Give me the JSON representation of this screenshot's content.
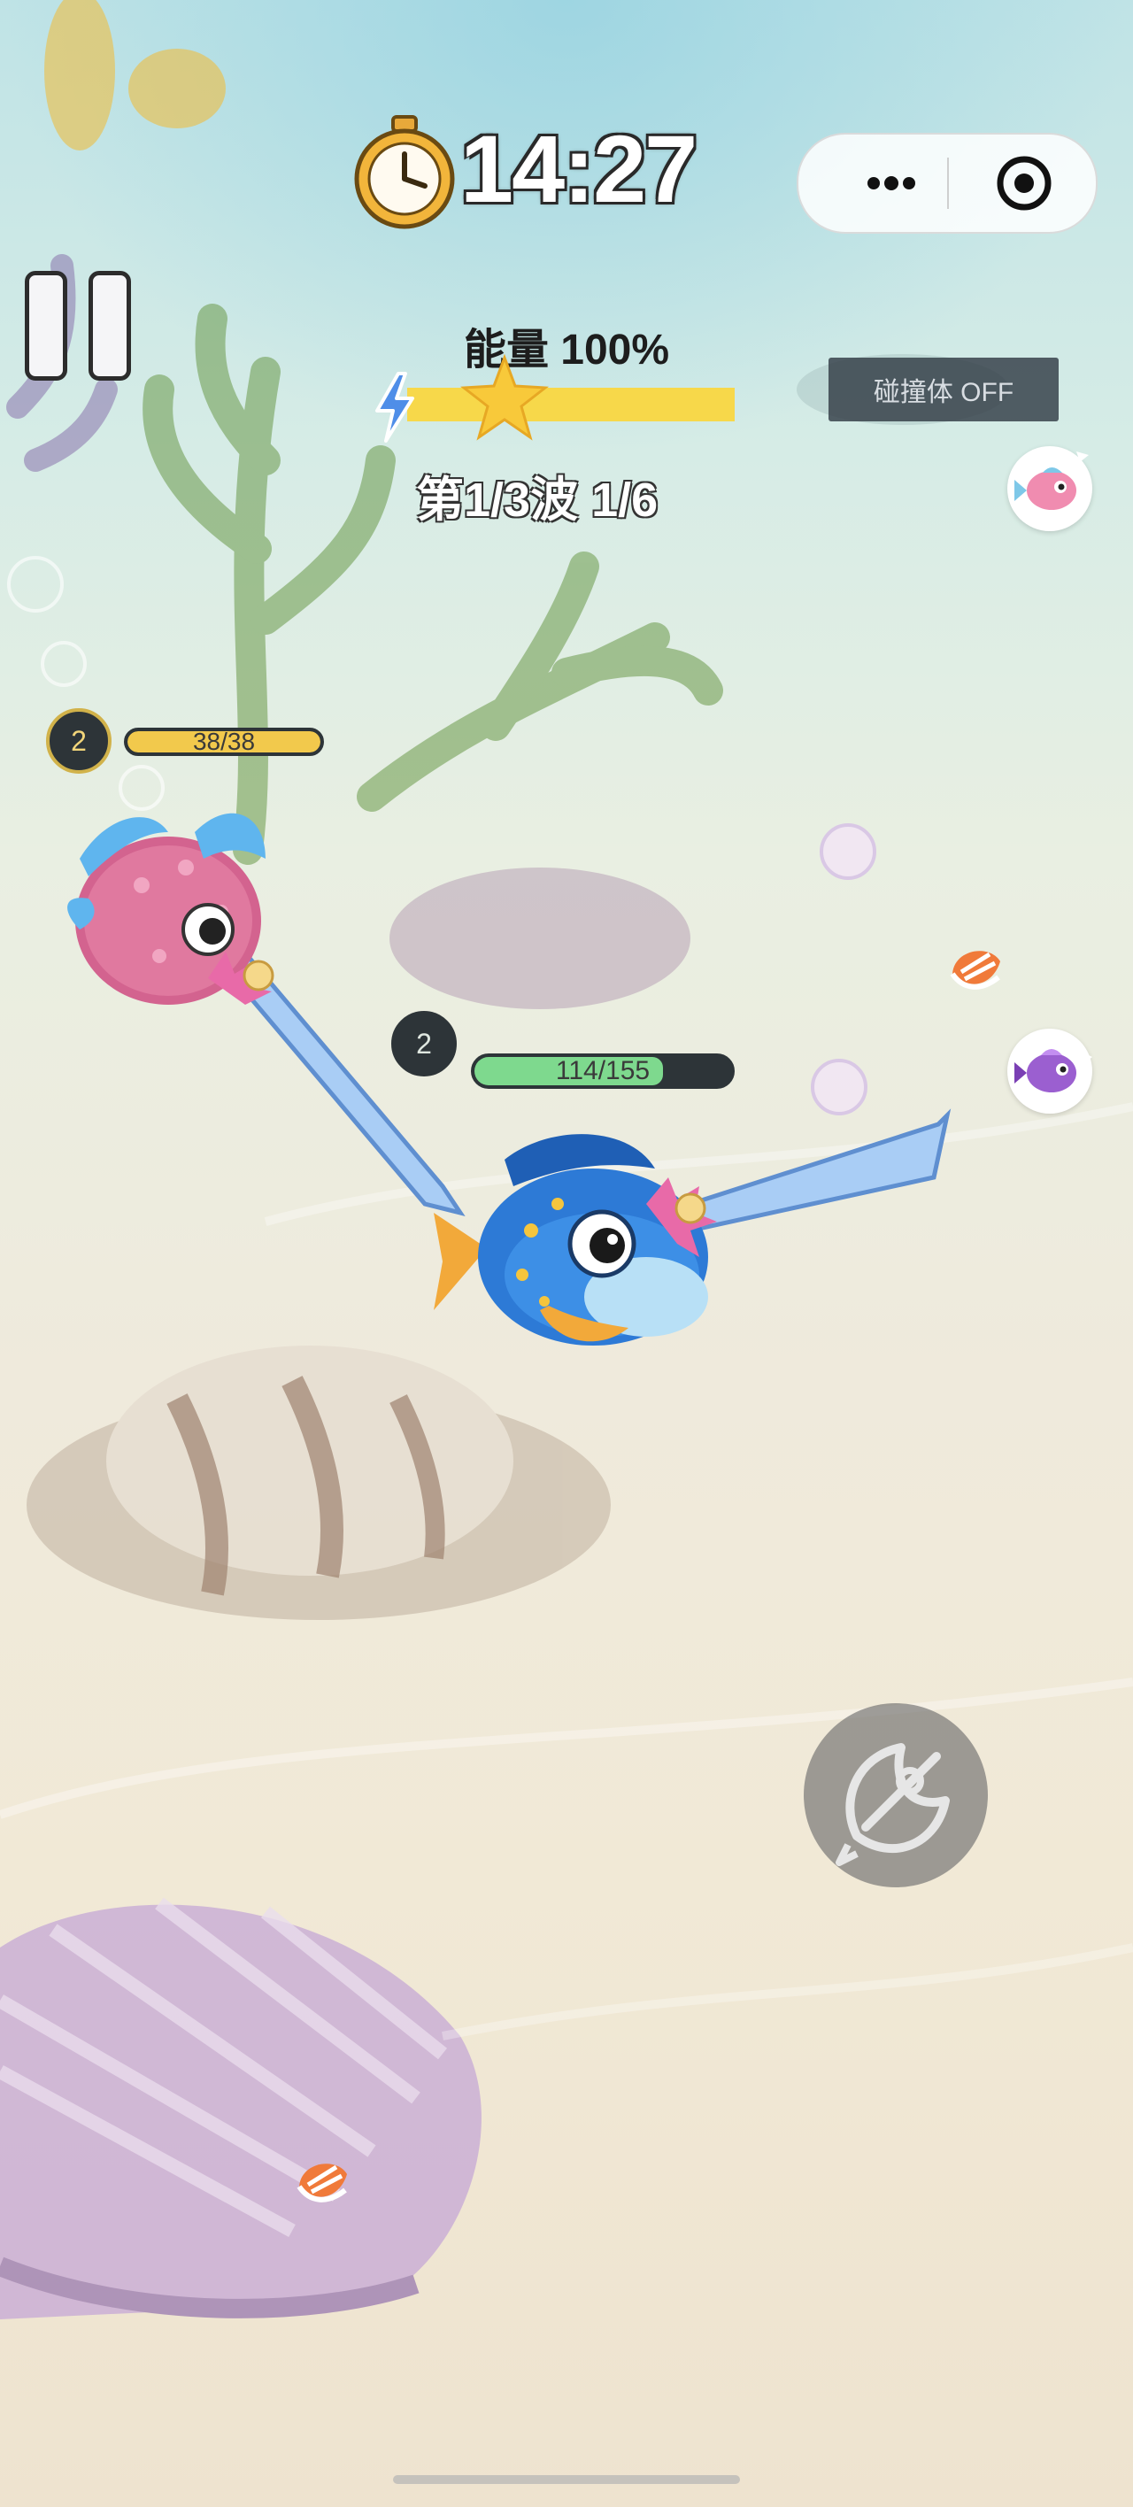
{
  "hud": {
    "timer": "14:27",
    "energy_label": "能量 100%",
    "energy_level": 1.0,
    "wave_label": "第1/3波  1/6",
    "collider_toggle": "碰撞体 OFF"
  },
  "enemy": {
    "level": "2",
    "hp_text": "38/38",
    "hp_fraction": 1.0
  },
  "player": {
    "level": "2",
    "hp_text": "114/155",
    "hp_fraction": 0.735
  },
  "icons": {
    "timer": "stopwatch-icon",
    "pause": "pause-icon",
    "energy": "lightning-icon",
    "capsule_more": "more-dots-icon",
    "capsule_close": "target-close-icon",
    "boost": "rocket-icon"
  },
  "colors": {
    "energy": "#f7d84a",
    "enemy_hp": "#f2c94c",
    "player_hp": "#7ed98e"
  }
}
